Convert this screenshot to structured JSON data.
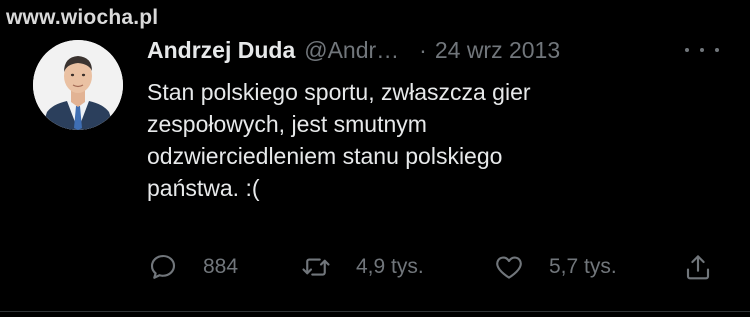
{
  "watermark": "www.wiocha.pl",
  "tweet": {
    "author_name": "Andrzej Duda",
    "author_handle": "@Andr…",
    "separator": "·",
    "date": "24 wrz 2013",
    "text_lines": [
      "Stan polskiego sportu, zwłaszcza gier",
      "zespołowych, jest smutnym",
      "odzwierciedleniem stanu polskiego",
      "państwa. :("
    ],
    "actions": {
      "reply_count": "884",
      "retweet_count": "4,9 tys.",
      "like_count": "5,7 tys."
    }
  },
  "icons": {
    "avatar": "profile-photo",
    "more": "more-horizontal-icon",
    "reply": "speech-bubble-icon",
    "retweet": "retweet-arrows-icon",
    "like": "heart-icon",
    "share": "share-upload-icon"
  },
  "colors": {
    "background": "#000000",
    "primary_text": "#e7e9ea",
    "secondary_text": "#71767b",
    "divider": "#2f3336"
  }
}
